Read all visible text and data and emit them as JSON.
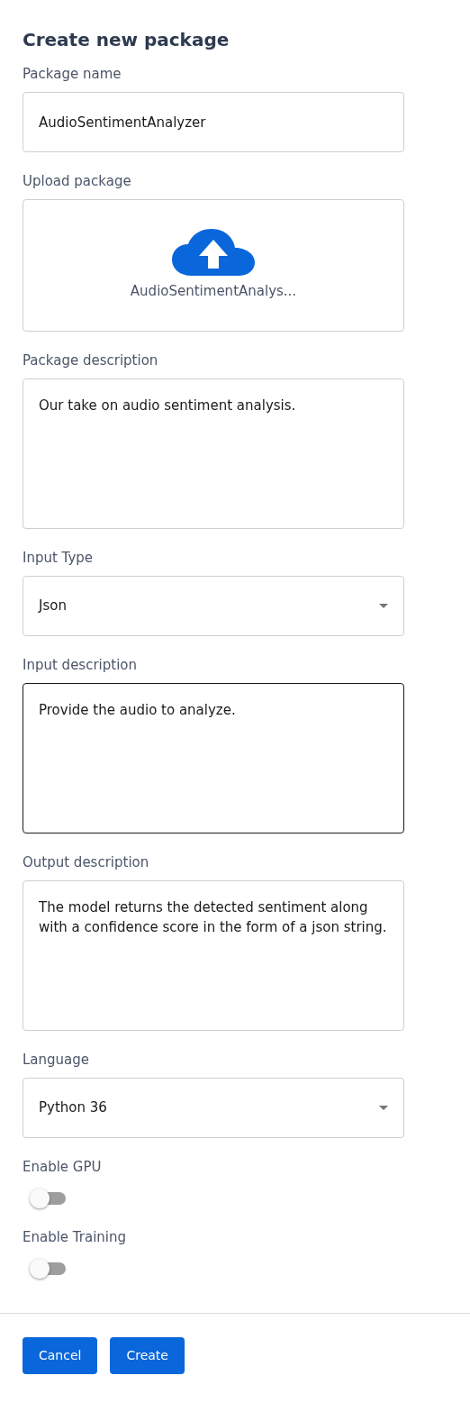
{
  "title": "Create new package",
  "fields": [
    {
      "kind": "text",
      "label": "Package name",
      "value": "AudioSentimentAnalyzer",
      "focused": false
    },
    {
      "kind": "upload",
      "label": "Upload package",
      "file": "AudioSentimentAnalys..."
    },
    {
      "kind": "textarea",
      "label": "Package description",
      "value": "Our take on audio sentiment analysis.",
      "focused": false
    },
    {
      "kind": "select",
      "label": "Input Type",
      "value": "Json"
    },
    {
      "kind": "textarea",
      "label": "Input description",
      "value": "Provide the audio to analyze.",
      "focused": true
    },
    {
      "kind": "textarea",
      "label": "Output description",
      "value": "The model returns the detected sentiment along with a confidence score in the form of a json string.",
      "focused": false
    },
    {
      "kind": "select",
      "label": "Language",
      "value": "Python 36"
    },
    {
      "kind": "toggle",
      "label": "Enable GPU",
      "on": false
    },
    {
      "kind": "toggle",
      "label": "Enable Training",
      "on": false
    }
  ],
  "buttons": [
    "Cancel",
    "Create"
  ]
}
